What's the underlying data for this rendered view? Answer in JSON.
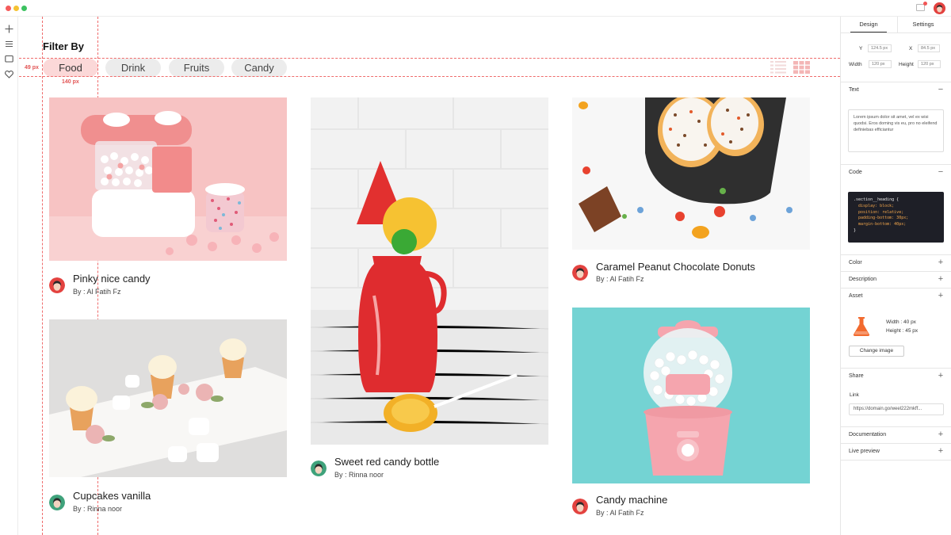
{
  "window": {
    "controls": [
      "close",
      "minimize",
      "maximize"
    ],
    "mail_icon": "mail-icon",
    "avatar_icon": "user-avatar"
  },
  "rail": {
    "items": [
      {
        "icon": "plus-icon"
      },
      {
        "icon": "menu-icon"
      },
      {
        "icon": "message-icon"
      },
      {
        "icon": "heart-icon"
      }
    ]
  },
  "filter": {
    "title": "Filter By",
    "chips": [
      "Food",
      "Drink",
      "Fruits",
      "Candy"
    ],
    "active_chip": "Food",
    "guide_height_label": "49 px",
    "guide_width_label": "140 px"
  },
  "cards": [
    {
      "title": "Pinky nice candy",
      "author": "By : Al Fatih Fz",
      "image": "candy-dispenser-photo"
    },
    {
      "title": "Cupcakes vanilla",
      "author": "By : Rinna noor",
      "image": "cupcakes-photo"
    },
    {
      "title": "Sweet red candy bottle",
      "author": "By : Rinna noor",
      "image": "red-candy-bottle-photo"
    },
    {
      "title": "Caramel Peanut Chocolate Donuts",
      "author": "By : Al Fatih Fz",
      "image": "donuts-photo"
    },
    {
      "title": "Candy machine",
      "author": "By : Al Fatih Fz",
      "image": "gumball-machine-photo"
    }
  ],
  "panel": {
    "tabs": [
      "Design",
      "Settings"
    ],
    "active_tab": "Design",
    "fields": {
      "y_label": "Y",
      "y_value": "124.5 px",
      "x_label": "X",
      "x_value": "84.5 px",
      "width_label": "Width",
      "width_value": "120 px",
      "height_label": "Height",
      "height_value": "120 px"
    },
    "text_section": {
      "title": "Text",
      "content": "Lorem ipsum dolor sit amet, vel ex wisi quodsi. Eros doming vis eu, pro no eleifend definiebas efficiantur"
    },
    "code_section": {
      "title": "Code",
      "lines": [
        ".section__heading {",
        "  display: block;",
        "  position: relative;",
        "  padding-bottom: 30px;",
        "  margin-bottom: 40px;",
        "}"
      ]
    },
    "collapsed_sections": [
      "Color",
      "Description",
      "Asset"
    ],
    "asset": {
      "width_text": "Width : 40 px",
      "height_text": "Height : 45 px",
      "button": "Change image",
      "icon": "flask-icon"
    },
    "share": {
      "title": "Share",
      "link_label": "Link",
      "link_value": "https://domain.go/weel222mkff..."
    },
    "bottom_sections": [
      "Documentation",
      "Live preview"
    ]
  },
  "colors": {
    "accent": "#ef6b6b",
    "chip_active": "#fbd8d8",
    "chip": "#ececec"
  }
}
